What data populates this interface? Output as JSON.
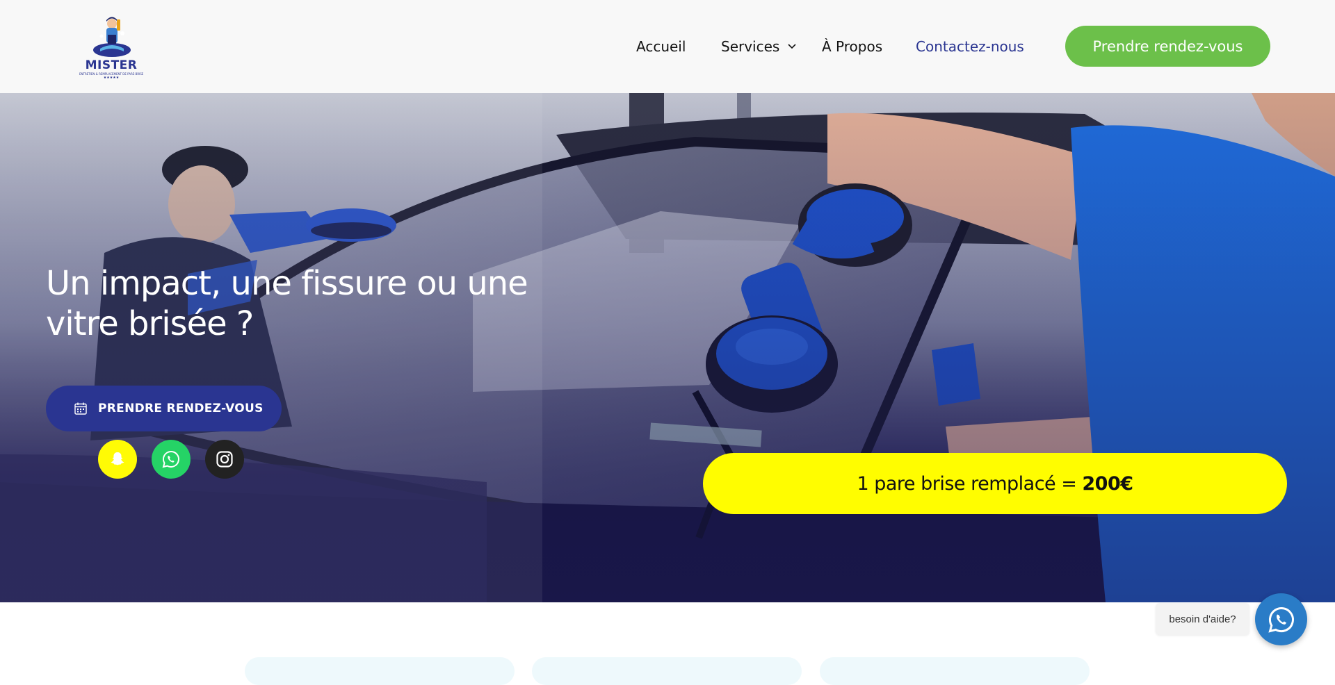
{
  "header": {
    "logo": {
      "name": "MISTER",
      "tagline": "ENTRETIEN & REMPLACEMENT DE PARE-BRISE",
      "stars": "★★★★★"
    },
    "nav": {
      "accueil": "Accueil",
      "services": "Services",
      "apropos": "À Propos",
      "contact": "Contactez-nous"
    },
    "cta_label": "Prendre rendez-vous"
  },
  "hero": {
    "title": "Un impact, une fissure ou une vitre brisée ?",
    "button_label": "PRENDRE RENDEZ-VOUS",
    "promo_text": "1 pare brise remplacé =",
    "promo_price": "200€"
  },
  "social": [
    {
      "icon": "snapchat-icon"
    },
    {
      "icon": "whatsapp-icon"
    },
    {
      "icon": "instagram-icon"
    }
  ],
  "help": {
    "label": "besoin d'aide?"
  },
  "colors": {
    "brand_navy": "#2a3591",
    "cta_green": "#6cc04a",
    "promo_yellow": "#fffd00",
    "whatsapp_green": "#25d366",
    "help_blue": "#2a7cc7"
  }
}
